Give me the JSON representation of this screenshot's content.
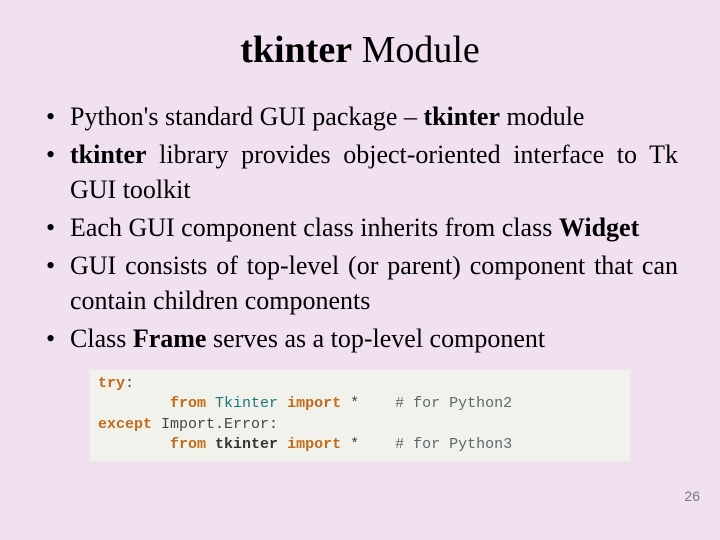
{
  "title": {
    "bold": "tkinter",
    "rest": " Module"
  },
  "bullets": {
    "b1": {
      "pre": "Python's standard GUI package – ",
      "bold": "tkinter",
      "post": " module"
    },
    "b2": {
      "bold": "tkinter",
      "post": " library provides object-oriented interface to Tk GUI toolkit"
    },
    "b3": {
      "pre": "Each GUI component class inherits from class ",
      "bold": "Widget"
    },
    "b4": {
      "text": "GUI consists of top-level (or parent) component that can contain children components"
    },
    "b5": {
      "pre": "Class ",
      "bold": "Frame",
      "post": " serves as a top-level component"
    }
  },
  "code": {
    "l1_kw": "try",
    "l1_colon": ":",
    "l2_from": "from",
    "l2_mod": "Tkinter",
    "l2_imp": "import",
    "l2_star": " *",
    "l2_cm": "# for Python2",
    "l3_kw": "except",
    "l3_err": " Import.Error:",
    "l4_from": "from",
    "l4_mod": "tkinter",
    "l4_imp": "import",
    "l4_star": " *",
    "l4_cm": "# for Python3"
  },
  "pagenum": "26"
}
